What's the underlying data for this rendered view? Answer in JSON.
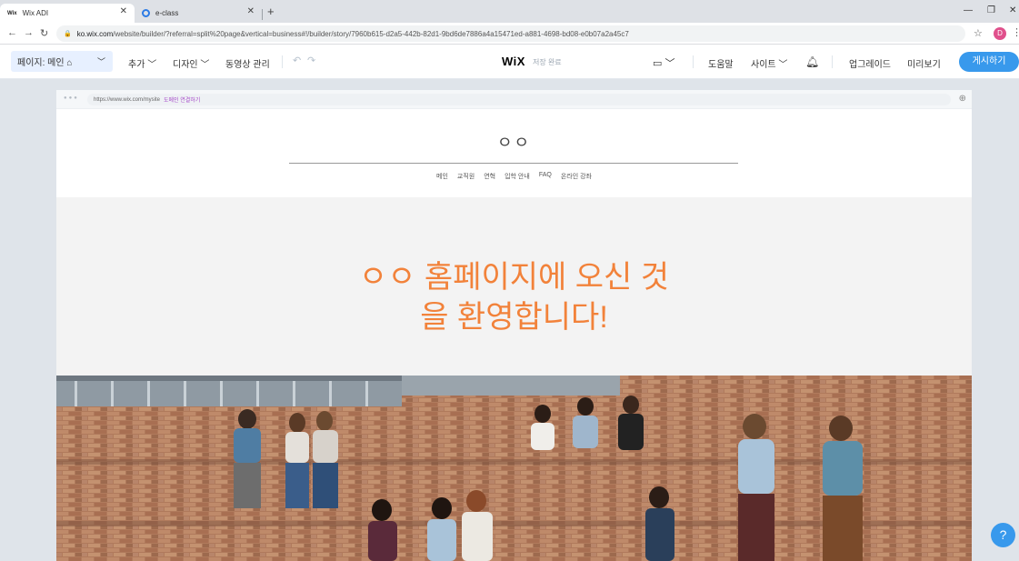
{
  "browser": {
    "tabs": [
      {
        "favicon": "Wix",
        "label": "Wix ADI"
      },
      {
        "favicon": "circle-icon",
        "label": "e-class"
      }
    ],
    "url_host": "ko.wix.com",
    "url_path": "/website/builder/?referral=split%20page&vertical=business#!/builder/story/7960b615-d2a5-442b-82d1-9bd6de7886a4a15471ed-a881-4698-bd08-e0b07a2a45c7",
    "avatar_letter": "D"
  },
  "editor": {
    "page_selector": "페이지: 메인 ⌂",
    "menu": {
      "add": "추가",
      "design": "디자인",
      "video": "동영상 관리"
    },
    "logo": "WiX",
    "save_status": "저장 완료",
    "right": {
      "help": "도움말",
      "site": "사이트",
      "upgrade": "업그레이드",
      "preview": "미리보기",
      "publish": "게시하기"
    }
  },
  "preview": {
    "url": "https://www.wix.com/mysite",
    "connect_domain": "도메인 연결하기",
    "site_title": "ㅇㅇ",
    "nav": [
      "메인",
      "교직원",
      "연혁",
      "입학 안내",
      "FAQ",
      "온라인 강좌"
    ],
    "hero_line1": "ㅇㅇ 홈페이지에 오신 것",
    "hero_line2": "을 환영합니다!"
  },
  "help_label": "?",
  "colors": {
    "accent": "#3899ec",
    "hero_text": "#f2823a"
  }
}
